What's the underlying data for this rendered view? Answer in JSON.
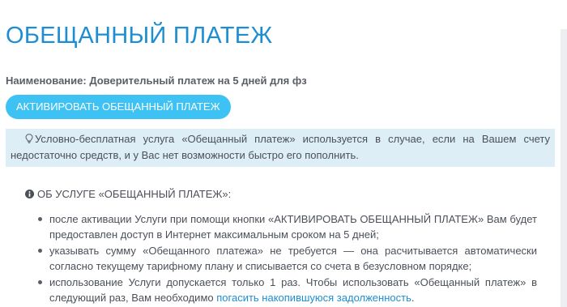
{
  "page": {
    "title": "ОБЕЩАННЫЙ ПЛАТЕЖ",
    "name_line": "Наименование: Доверительный платеж на 5 дней для фз"
  },
  "actions": {
    "activate_label": "АКТИВИРОВАТЬ ОБЕЩАННЫЙ ПЛАТЕЖ"
  },
  "notice": {
    "icon": "lightbulb-icon",
    "text": "Условно-бесплатная услуга «Обещанный платеж» используется в случае, если на Вашем счету недостаточно средств, и у Вас нет возможности быстро его пополнить."
  },
  "about": {
    "icon": "info-circle-icon",
    "heading": "ОБ УСЛУГЕ «ОБЕЩАННЫЙ ПЛАТЕЖ»:",
    "items": [
      {
        "text": "после активации Услуги при помощи кнопки «АКТИВИРОВАТЬ ОБЕЩАННЫЙ ПЛАТЕЖ» Вам будет предоставлен доступ в Интернет максимальным сроком на 5 дней;"
      },
      {
        "text": "указывать сумму «Обещанного платежа» не требуется — она расчитывается автоматически согласно текущему тарифному плану и списывается со счета в безусловном порядке;"
      },
      {
        "text": "использование Услуги допускается только 1 раз. Чтобы использовать «Обещанный платеж» в следующий раз, Вам необходимо ",
        "link": "погасить накопившуюся задолженность",
        "suffix": "."
      }
    ]
  },
  "colors": {
    "title": "#1e8ed2",
    "button_bg": "#3ec2f3",
    "notice_bg": "#ddeef7",
    "link": "#1e8ed2"
  }
}
